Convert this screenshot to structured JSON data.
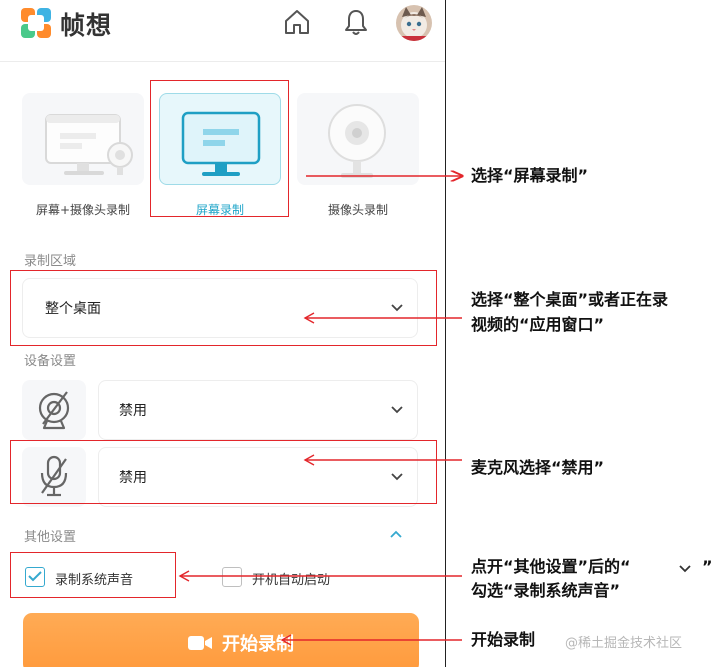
{
  "header": {
    "brand": "帧想",
    "icons": [
      "home-icon",
      "bell-icon",
      "avatar"
    ]
  },
  "modes": [
    {
      "label": "屏幕+摄像头录制",
      "selected": false
    },
    {
      "label": "屏幕录制",
      "selected": true
    },
    {
      "label": "摄像头录制",
      "selected": false
    }
  ],
  "record_area": {
    "label": "录制区域",
    "value": "整个桌面"
  },
  "device_settings": {
    "label": "设备设置",
    "camera_value": "禁用",
    "microphone_value": "禁用"
  },
  "other_settings": {
    "label": "其他设置",
    "expanded": true,
    "record_system_audio": {
      "label": "录制系统声音",
      "checked": true
    },
    "auto_start": {
      "label": "开机自动启动",
      "checked": false
    }
  },
  "start_button": {
    "label": "开始录制"
  },
  "annotations": {
    "a1": "选择“屏幕录制”",
    "a2_line1": "选择“整个桌面”或者正在录",
    "a2_line2": "视频的“应用窗口”",
    "a3": "麦克风选择“禁用”",
    "a4_line1": "点开“其他设置”后的“",
    "a4_line1_end": "”",
    "a4_line2": "勾选“录制系统声音”",
    "a5": "开始录制"
  },
  "watermark": "@稀土掘金技术社区",
  "colors": {
    "accent": "#21a6c9",
    "start_button": "#ff9f45",
    "annotation_red": "#e3262b"
  }
}
